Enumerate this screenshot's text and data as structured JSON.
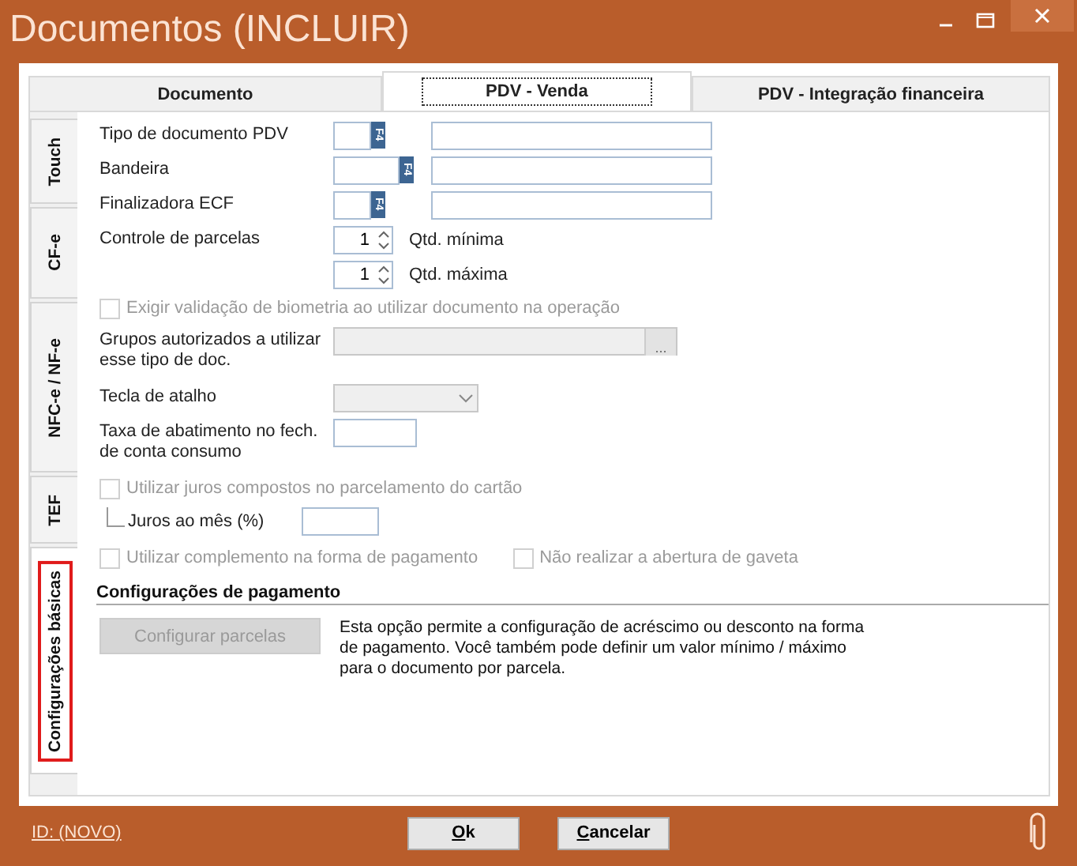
{
  "window": {
    "title": "Documentos (INCLUIR)"
  },
  "tabs": [
    {
      "label": "Documento",
      "selected": false
    },
    {
      "label": "PDV - Venda",
      "selected": true
    },
    {
      "label": "PDV - Integração financeira",
      "selected": false
    }
  ],
  "side_tabs": [
    {
      "label": "Touch",
      "selected": false
    },
    {
      "label": "CF-e",
      "selected": false
    },
    {
      "label": "NFC-e / NF-e",
      "selected": false
    },
    {
      "label": "TEF",
      "selected": false
    },
    {
      "label": "Configurações básicas",
      "selected": true
    }
  ],
  "form": [
    {
      "kind": "lookup",
      "label": "Tipo de documento PDV",
      "key": "F4"
    },
    {
      "kind": "lookup",
      "label": "Bandeira",
      "key": "F4"
    },
    {
      "kind": "lookup",
      "label": "Finalizadora ECF",
      "key": "F4"
    },
    {
      "kind": "spinners",
      "label": "Controle de parcelas",
      "spinners": [
        {
          "value": "1",
          "caption": "Qtd. mínima"
        },
        {
          "value": "1",
          "caption": "Qtd. máxima"
        }
      ]
    },
    {
      "kind": "checks",
      "checks": [
        {
          "label": "Exigir validação de biometria ao utilizar documento na operação",
          "checked": false,
          "disabled": true
        }
      ]
    },
    {
      "kind": "picker",
      "label": "Grupos autorizados a utilizar esse tipo de doc.",
      "button": "...",
      "disabled": true
    },
    {
      "kind": "combo",
      "label": "Tecla de atalho",
      "disabled": true
    },
    {
      "kind": "text",
      "label": "Taxa de abatimento no fech. de conta consumo"
    },
    {
      "kind": "checks",
      "checks": [
        {
          "label": "Utilizar juros compostos no parcelamento do cartão",
          "checked": false,
          "disabled": true
        }
      ]
    },
    {
      "kind": "subfield",
      "label": "Juros ao mês (%)"
    },
    {
      "kind": "checks",
      "checks": [
        {
          "label": "Utilizar complemento na forma de pagamento",
          "checked": false,
          "disabled": true
        },
        {
          "label": "Não realizar a abertura de gaveta",
          "checked": false,
          "disabled": true
        }
      ]
    }
  ],
  "payment": {
    "title": "Configurações de pagamento",
    "button": {
      "label": "Configurar parcelas",
      "disabled": true
    },
    "description": "Esta opção permite a configuração de acréscimo ou desconto na forma de pagamento. Você também pode definir um valor mínimo / máximo para o documento por parcela."
  },
  "footer": {
    "id_link": "ID: (NOVO)",
    "buttons": [
      {
        "label": "Ok"
      },
      {
        "label": "Cancelar"
      }
    ]
  }
}
